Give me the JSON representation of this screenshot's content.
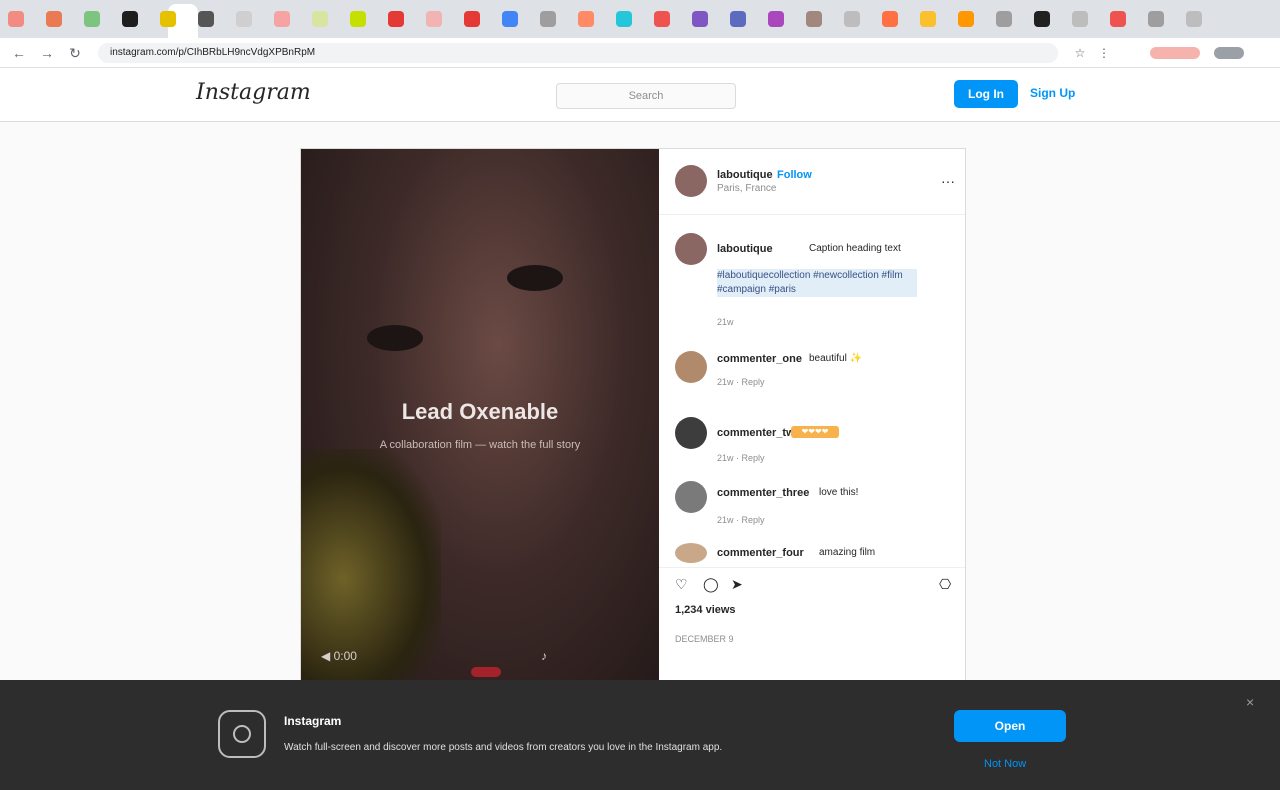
{
  "browser": {
    "url": "instagram.com/p/CIhBRbLH9ncVdgXPBnRpM",
    "tab_colors": [
      "#f28b82",
      "#ea7a54",
      "#7cc47f",
      "#1e1e1e",
      "#e5c100",
      "#555555",
      "#cfcfcf",
      "#f5a3a3",
      "#d7e5a1",
      "#c5e000",
      "#e53935",
      "#f2b3b3",
      "#e53935",
      "#4285f4",
      "#9e9e9e",
      "#ff8a65",
      "#26c6da",
      "#ef5350",
      "#7e57c2",
      "#5c6bc0",
      "#ab47bc",
      "#a1887f",
      "#bdbdbd",
      "#ff7043",
      "#fbc02d",
      "#ff9800",
      "#9e9e9e",
      "#212121",
      "#bdbdbd",
      "#ef5350",
      "#9e9e9e",
      "#bdbdbd"
    ]
  },
  "nav": {
    "logo": "Instagram",
    "search_placeholder": "Search",
    "login_label": "Log In",
    "signup_label": "Sign Up"
  },
  "post": {
    "media_title": "Lead Oxenable",
    "media_subtitle": "A collaboration film — watch the full story",
    "media_controls": {
      "left": "◀ 0:00",
      "right": "♪"
    },
    "author": {
      "username": "laboutique",
      "location": "Paris, France",
      "follow_label": "Follow",
      "more_icon": "···"
    },
    "caption": {
      "username": "laboutique",
      "text": "Caption heading text",
      "link_text": "#laboutiquecollection #newcollection #film #campaign #paris",
      "meta": "21w"
    },
    "comments": [
      {
        "username": "commenter_one",
        "text": "beautiful ✨",
        "meta": "21w · Reply"
      },
      {
        "username": "commenter_two",
        "text": "",
        "badge": "❤❤❤❤",
        "meta": "21w · Reply"
      },
      {
        "username": "commenter_three",
        "text": "love this!",
        "meta": "21w · Reply"
      },
      {
        "username": "commenter_four",
        "text": "amazing film",
        "meta": ""
      }
    ],
    "actions": {
      "like_icon": "♡",
      "comment_icon": "◯",
      "share_icon": "➤",
      "save_icon": "⎔"
    },
    "likes": "1,234 views",
    "date": "DECEMBER 9"
  },
  "banner": {
    "title": "Instagram",
    "description": "Watch full-screen and discover more posts and videos from creators you love in the Instagram app.",
    "open_label": "Open",
    "not_now_label": "Not Now",
    "close_icon": "×"
  }
}
